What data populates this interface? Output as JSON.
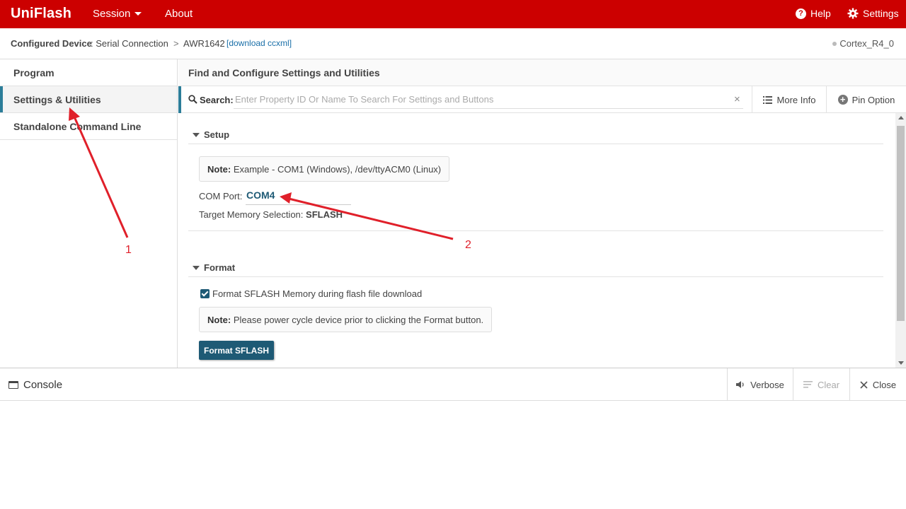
{
  "topbar": {
    "brand": "UniFlash",
    "session_label": "Session",
    "about_label": "About",
    "help_label": "Help",
    "settings_label": "Settings",
    "background_color": "#cc0000"
  },
  "breadcrumb": {
    "label": "Configured Device",
    "connection": ": Serial Connection",
    "separator": ">",
    "device": "AWR1642",
    "download": "[download ccxml]",
    "core": "Cortex_R4_0"
  },
  "sidebar": {
    "items": [
      {
        "label": "Program"
      },
      {
        "label": "Settings & Utilities"
      },
      {
        "label": "Standalone Command Line"
      }
    ]
  },
  "main": {
    "title": "Find and Configure Settings and Utilities",
    "search": {
      "label": "Search:",
      "placeholder": "Enter Property ID Or Name To Search For Settings and Buttons",
      "clear": "×"
    },
    "more_info_label": "More Info",
    "pin_option_label": "Pin Option",
    "setup": {
      "title": "Setup",
      "note_bold": "Note:",
      "note_text": " Example - COM1 (Windows), /dev/ttyACM0 (Linux)",
      "com_port_label": "COM Port:",
      "com_port_value": "COM4",
      "target_memory_label": "Target Memory Selection:",
      "target_memory_value": "SFLASH"
    },
    "format": {
      "title": "Format",
      "checkbox_label": "Format SFLASH Memory during flash file download",
      "checkbox_checked": true,
      "note_bold": "Note:",
      "note_text": " Please power cycle device prior to clicking the Format button.",
      "button_label": "Format SFLASH"
    }
  },
  "console": {
    "title": "Console",
    "verbose_label": "Verbose",
    "clear_label": "Clear",
    "close_label": "Close"
  },
  "annotations": {
    "label_1": "1",
    "label_2": "2",
    "arrow_color": "#e0202a"
  },
  "colors": {
    "accent_teal": "#2c7d99",
    "button_dark": "#1e5a75",
    "link_blue": "#1a6fa8"
  }
}
